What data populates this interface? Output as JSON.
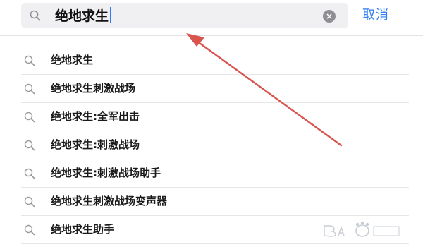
{
  "search": {
    "query": "绝地求生",
    "cancel_label": "取消",
    "clear_icon": "×"
  },
  "suggestions": [
    {
      "label": "绝地求生"
    },
    {
      "label": "绝地求生刺激战场"
    },
    {
      "label": "绝地求生:全军出击"
    },
    {
      "label": "绝地求生:刺激战场"
    },
    {
      "label": "绝地求生:刺激战场助手"
    },
    {
      "label": "绝地求生刺激战场变声器"
    },
    {
      "label": "绝地求生助手"
    }
  ],
  "icons": {
    "search": "search-icon",
    "clear": "clear-icon"
  },
  "colors": {
    "accent": "#2f7cf6",
    "annotation_arrow": "#d9534f",
    "text": "#1a1a1a",
    "search_box_bg": "#f0f0f2"
  }
}
